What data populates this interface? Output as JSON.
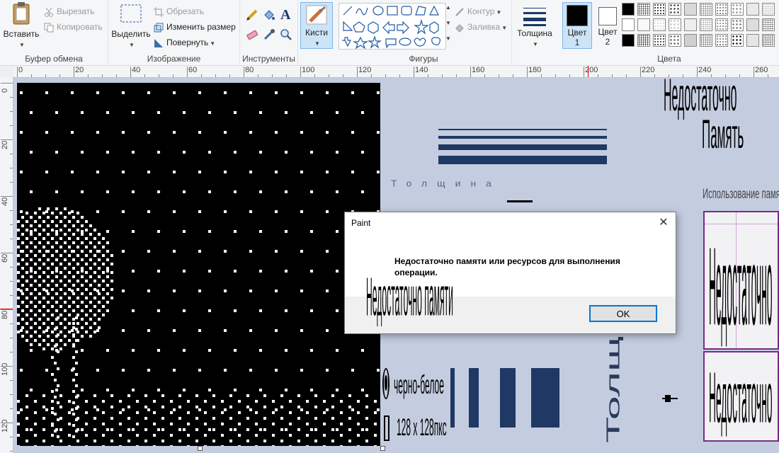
{
  "ribbon": {
    "clipboard": {
      "paste_label": "Вставить",
      "cut_label": "Вырезать",
      "copy_label": "Копировать",
      "group_label": "Буфер обмена"
    },
    "image": {
      "select_label": "Выделить",
      "crop_label": "Обрезать",
      "resize_label": "Изменить размер",
      "rotate_label": "Повернуть",
      "group_label": "Изображение"
    },
    "tools": {
      "group_label": "Инструменты"
    },
    "brushes": {
      "label": "Кисти"
    },
    "shapes": {
      "outline_label": "Контур",
      "fill_label": "Заливка",
      "group_label": "Фигуры"
    },
    "size": {
      "label": "Толщина"
    },
    "colors": {
      "color1_label_line1": "Цвет",
      "color1_label_line2": "1",
      "color2_label_line1": "Цвет",
      "color2_label_line2": "2",
      "group_label": "Цвета"
    }
  },
  "rulers": {
    "horizontal": [
      "0",
      "20",
      "40",
      "60",
      "80",
      "100",
      "120",
      "140",
      "160",
      "180",
      "200",
      "220",
      "240",
      "260"
    ],
    "vertical": [
      "0",
      "20",
      "40",
      "60",
      "80",
      "100",
      "120"
    ]
  },
  "dialog": {
    "title": "Paint",
    "message": "Недостаточно памяти или ресурсов для выполнения операции.",
    "ok_label": "OK"
  },
  "artifacts": {
    "mem_title_line1": "Недостаточно",
    "mem_title_line2": "Память",
    "size_word": "Толщина",
    "usage_text": "Использование памяти",
    "dialog_overlay": "Недостаточно памяти",
    "panel_text_1": "Недостаточно",
    "panel_text_2": "Недостаточно",
    "bw_label": "черно-белое",
    "dims_label": "128 х 128пкс",
    "size_vertical": "Толщина"
  },
  "colors": {
    "accent": "#0078d7",
    "navy": "#1f3864",
    "canvas_bg": "#000000",
    "workspace": "#c4cde0"
  }
}
